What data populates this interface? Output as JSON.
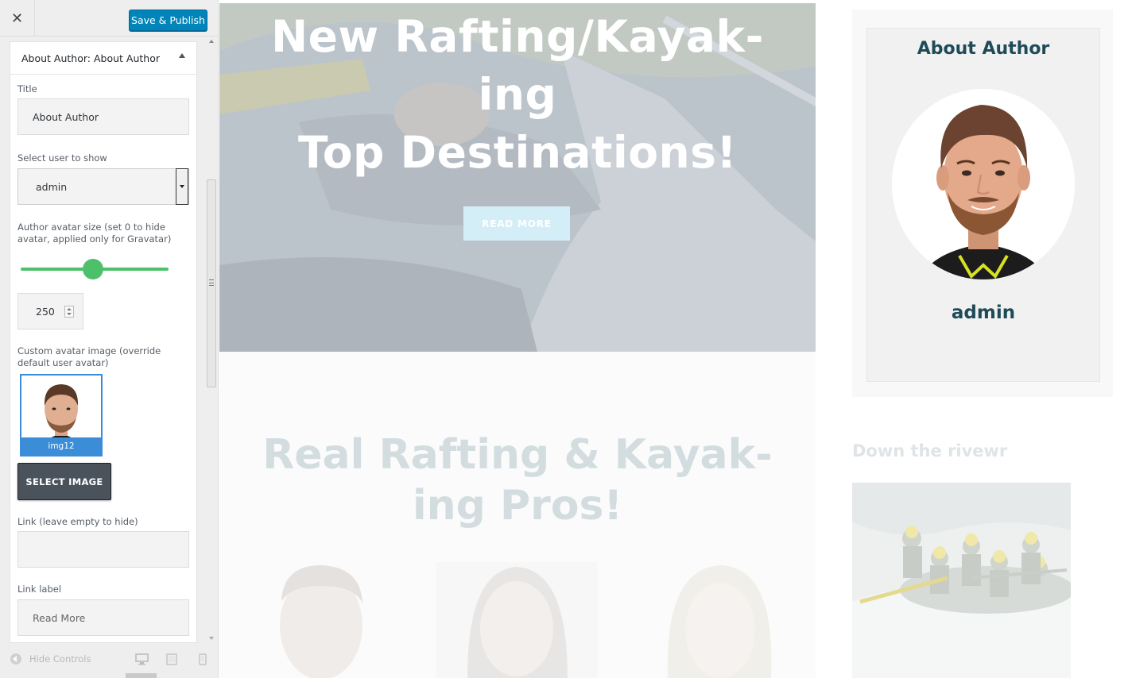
{
  "customizer": {
    "close_icon": "close-icon",
    "publish_label": "Save & Publish",
    "section_title": "About Author: About Author",
    "title_label": "Title",
    "title_value": "About Author",
    "user_label": "Select user to show",
    "user_value": "admin",
    "avatar_size_label": "Author avatar size (set 0 to hide avatar, applied only for Gravatar)",
    "avatar_size_value": "250",
    "avatar_size_fraction": 0.49,
    "custom_avatar_label": "Custom avatar image (override default user avatar)",
    "image_caption": "img12",
    "select_image_label": "SELECT IMAGE",
    "link_label": "Link (leave empty to hide)",
    "link_value": "",
    "link_text_label": "Link label",
    "link_text_placeholder": "Read More",
    "hide_controls_label": "Hide Controls",
    "devices": [
      "desktop-icon",
      "tablet-icon",
      "mobile-icon"
    ]
  },
  "preview": {
    "hero_title_line1": "New Rafting/Kayak-",
    "hero_title_line2": "ing",
    "hero_title_line3": "Top Destinations!",
    "hero_button": "READ MORE",
    "pros_title_line1": "Real Rafting & Kayak-",
    "pros_title_line2": "ing Pros!",
    "widget_title": "About Author",
    "widget_name": "admin",
    "down_title": "Down the rivewr"
  },
  "colors": {
    "accent": "#0085ba",
    "slider": "#4ec06b",
    "widget_text": "#1e4b57"
  }
}
